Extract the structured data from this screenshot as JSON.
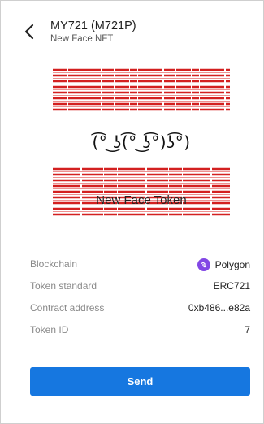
{
  "header": {
    "title": "MY721 (M721P)",
    "subtitle": "New Face NFT",
    "back_icon": "chevron-left-icon"
  },
  "nft_image": {
    "face_text": "(͡° ͜ʖ(͡° ͜ʖ͡°)ʖ͡°)",
    "caption": "New Face Token",
    "accent_color": "#d32020"
  },
  "details": {
    "rows": [
      {
        "label": "Blockchain",
        "value": "Polygon",
        "icon": "polygon-icon",
        "icon_color": "#8247e5"
      },
      {
        "label": "Token standard",
        "value": "ERC721"
      },
      {
        "label": "Contract address",
        "value": "0xb486...e82a"
      },
      {
        "label": "Token ID",
        "value": "7"
      }
    ]
  },
  "actions": {
    "send_label": "Send",
    "send_color": "#1677e0"
  }
}
